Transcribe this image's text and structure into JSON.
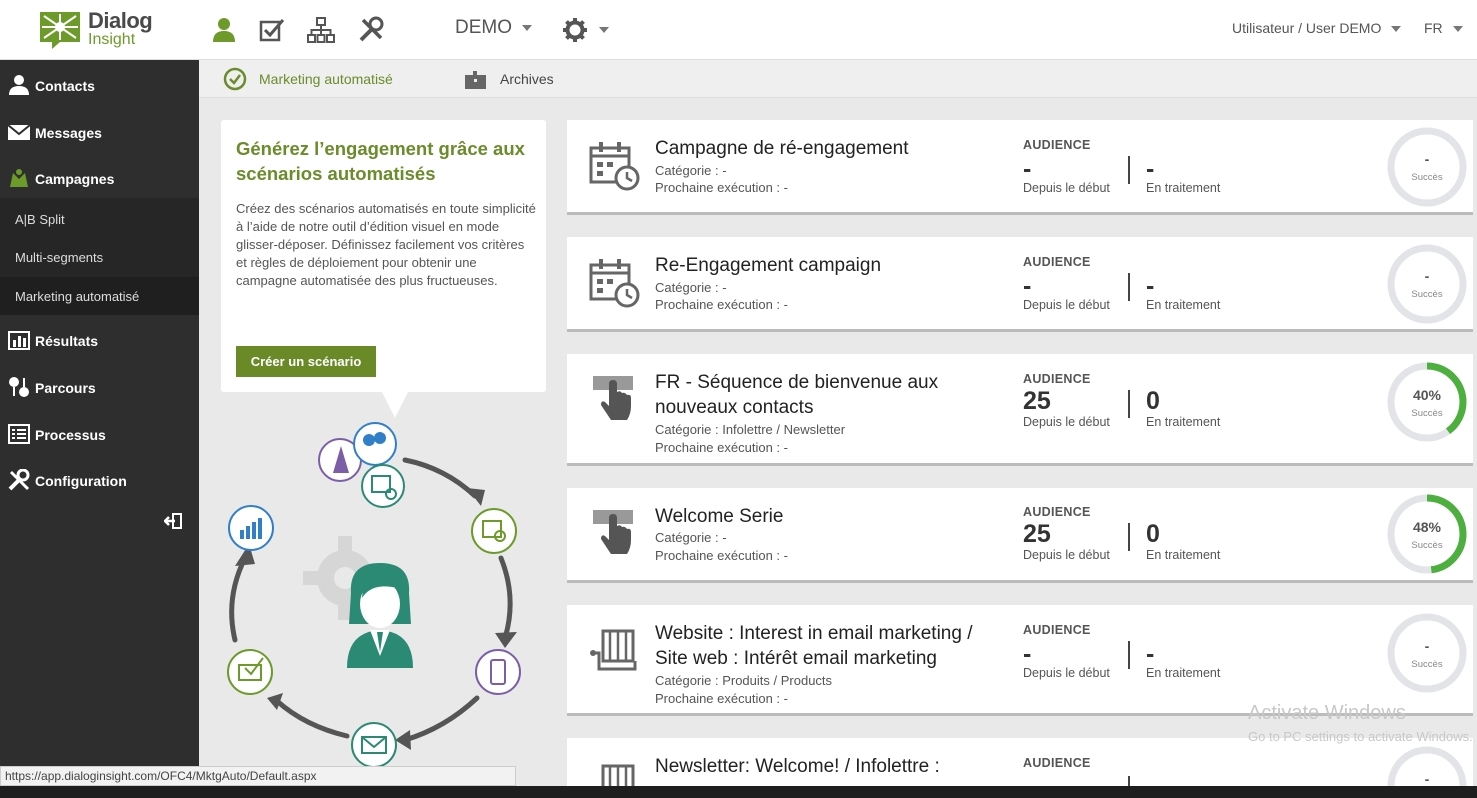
{
  "header": {
    "logo_line1": "Dialog",
    "logo_line2": "Insight",
    "account": "DEMO",
    "user": "Utilisateur / User DEMO",
    "lang": "FR"
  },
  "sidebar": {
    "items": [
      {
        "label": "Contacts"
      },
      {
        "label": "Messages"
      },
      {
        "label": "Campagnes"
      },
      {
        "label": "Résultats"
      },
      {
        "label": "Parcours"
      },
      {
        "label": "Processus"
      },
      {
        "label": "Configuration"
      }
    ],
    "subitems": [
      {
        "label": "A|B Split"
      },
      {
        "label": "Multi-segments"
      },
      {
        "label": "Marketing automatisé"
      }
    ]
  },
  "tabs": [
    {
      "label": "Marketing automatisé"
    },
    {
      "label": "Archives"
    }
  ],
  "promo": {
    "title": "Générez l’engagement grâce aux scénarios automatisés",
    "text": "Créez des scénarios automatisés en toute simplicité à l’aide de notre outil d’édition visuel en mode glisser-déposer. Définissez facilement vos critères et règles de déploiement pour obtenir une campagne automatisée des plus fructueuses.",
    "button": "Créer un scénario"
  },
  "labels": {
    "audience": "AUDIENCE",
    "since_start": "Depuis le début",
    "processing": "En traitement",
    "success": "Succès"
  },
  "campaigns": [
    {
      "name": "Campagne de ré-engagement",
      "category": "Catégorie : -",
      "next": "Prochaine exécution : -",
      "audience": "-",
      "processing": "-",
      "success": "-",
      "success_pct": 0
    },
    {
      "name": "Re-Engagement campaign",
      "category": "Catégorie : -",
      "next": "Prochaine exécution : -",
      "audience": "-",
      "processing": "-",
      "success": "-",
      "success_pct": 0
    },
    {
      "name": "FR - Séquence de bienvenue aux nouveaux contacts",
      "category": "Catégorie : Infolettre / Newsletter",
      "next": "Prochaine exécution : -",
      "audience": "25",
      "processing": "0",
      "success": "40%",
      "success_pct": 40
    },
    {
      "name": "Welcome Serie",
      "category": "Catégorie : -",
      "next": "Prochaine exécution : -",
      "audience": "25",
      "processing": "0",
      "success": "48%",
      "success_pct": 48
    },
    {
      "name": "Website : Interest in email marketing / Site web : Intérêt email marketing",
      "category": "Catégorie : Produits / Products",
      "next": "Prochaine exécution : -",
      "audience": "-",
      "processing": "-",
      "success": "-",
      "success_pct": 0
    },
    {
      "name": "Newsletter: Welcome! / Infolettre :",
      "category": "",
      "next": "",
      "audience": "",
      "processing": "",
      "success": "-",
      "success_pct": 0
    }
  ],
  "status_url": "https://app.dialoginsight.com/OFC4/MktgAuto/Default.aspx",
  "watermark": {
    "line1": "Activate Windows",
    "line2": "Go to PC settings to activate Windows."
  },
  "colors": {
    "accent": "#6a8a28",
    "sidebar": "#2e2e2e",
    "teal": "#2b8a74",
    "gauge_fill": "#4caf3e",
    "gauge_track": "#e2e4e8"
  }
}
